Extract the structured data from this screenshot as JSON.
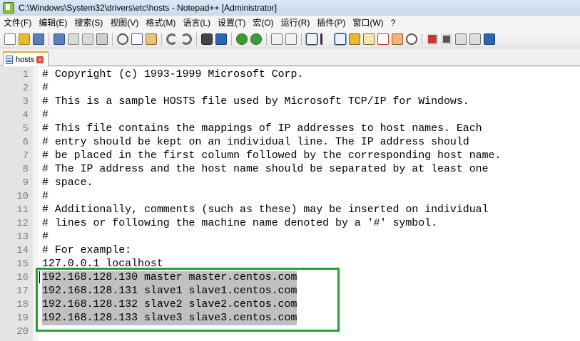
{
  "window": {
    "title": "C:\\Windows\\System32\\drivers\\etc\\hosts - Notepad++ [Administrator]"
  },
  "menu": [
    "文件(F)",
    "编辑(E)",
    "搜索(S)",
    "视图(V)",
    "格式(M)",
    "语言(L)",
    "设置(T)",
    "宏(O)",
    "运行(R)",
    "插件(P)",
    "窗口(W)",
    "?"
  ],
  "toolbar": {
    "icons": [
      "new-file-icon",
      "open-file-icon",
      "save-icon",
      "save-all-icon",
      "close-icon",
      "close-all-icon",
      "print-icon",
      "cut-icon",
      "copy-icon",
      "paste-icon",
      "undo-icon",
      "redo-icon",
      "find-icon",
      "replace-icon",
      "zoom-in-icon",
      "zoom-out-icon",
      "sync-vertical-icon",
      "sync-horizontal-icon",
      "word-wrap-icon",
      "show-all-chars-icon",
      "indent-guide-icon",
      "language-define-icon",
      "doc-map-icon",
      "function-list-icon",
      "folder-workspace-icon",
      "monitor-icon",
      "record-macro-icon",
      "stop-record-icon",
      "play-macro-icon",
      "run-macro-multiple-icon",
      "save-macro-icon"
    ],
    "colors": {
      "accent_blue": "#2a66b5",
      "accent_green": "#3d9b35",
      "accent_red": "#c8372d",
      "accent_yellow": "#e8b830"
    }
  },
  "tab": {
    "label": "hosts",
    "close_glyph": "×"
  },
  "editor": {
    "lines": [
      {
        "num": "1",
        "text": "# Copyright (c) 1993-1999 Microsoft Corp."
      },
      {
        "num": "2",
        "text": "#"
      },
      {
        "num": "3",
        "text": "# This is a sample HOSTS file used by Microsoft TCP/IP for Windows."
      },
      {
        "num": "4",
        "text": "#"
      },
      {
        "num": "5",
        "text": "# This file contains the mappings of IP addresses to host names. Each"
      },
      {
        "num": "6",
        "text": "# entry should be kept on an individual line. The IP address should"
      },
      {
        "num": "7",
        "text": "# be placed in the first column followed by the corresponding host name."
      },
      {
        "num": "8",
        "text": "# The IP address and the host name should be separated by at least one"
      },
      {
        "num": "9",
        "text": "# space."
      },
      {
        "num": "10",
        "text": "#"
      },
      {
        "num": "11",
        "text": "# Additionally, comments (such as these) may be inserted on individual"
      },
      {
        "num": "12",
        "text": "# lines or following the machine name denoted by a '#' symbol."
      },
      {
        "num": "13",
        "text": "#"
      },
      {
        "num": "14",
        "text": "# For example:"
      },
      {
        "num": "15",
        "text": "127.0.0.1 localhost"
      },
      {
        "num": "16",
        "text": "192.168.128.130 master master.centos.com"
      },
      {
        "num": "17",
        "text": "192.168.128.131 slave1 slave1.centos.com"
      },
      {
        "num": "18",
        "text": "192.168.128.132 slave2 slave2.centos.com"
      },
      {
        "num": "19",
        "text": "192.168.128.133 slave3 slave3.centos.com"
      },
      {
        "num": "20",
        "text": ""
      }
    ],
    "selected_lines": [
      16,
      17,
      18,
      19
    ],
    "highlight_color": "#1fa33a",
    "selection_color": "#c0c0c0"
  }
}
